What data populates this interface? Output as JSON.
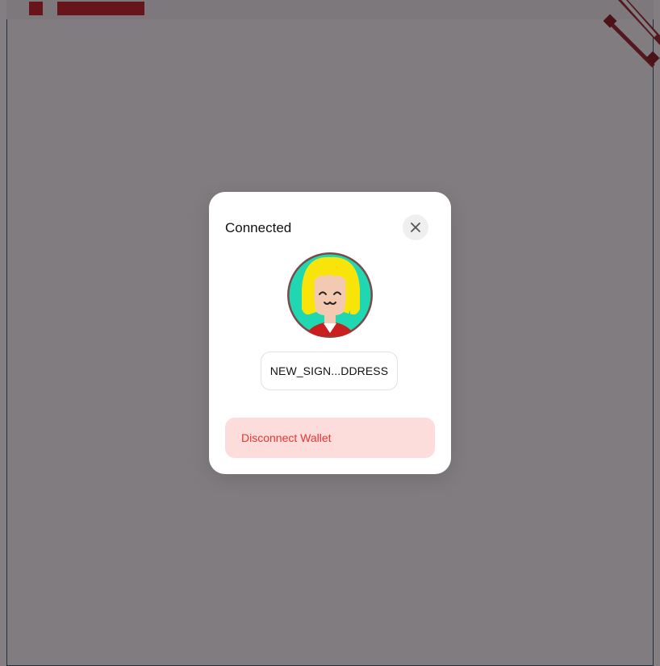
{
  "modal": {
    "title": "Connected",
    "close_icon": "close-icon",
    "avatar_icon": "avatar-illustration",
    "address": "NEW_SIGN...DDRESS",
    "disconnect_label": "Disconnect Wallet"
  },
  "colors": {
    "overlay": "#7f7a7e",
    "modal_bg": "#ffffff",
    "disconnect_bg": "#fddcdc",
    "disconnect_text": "#e8362e",
    "avatar_bg": "#1fd8b2",
    "accent_red": "#c4232a"
  }
}
